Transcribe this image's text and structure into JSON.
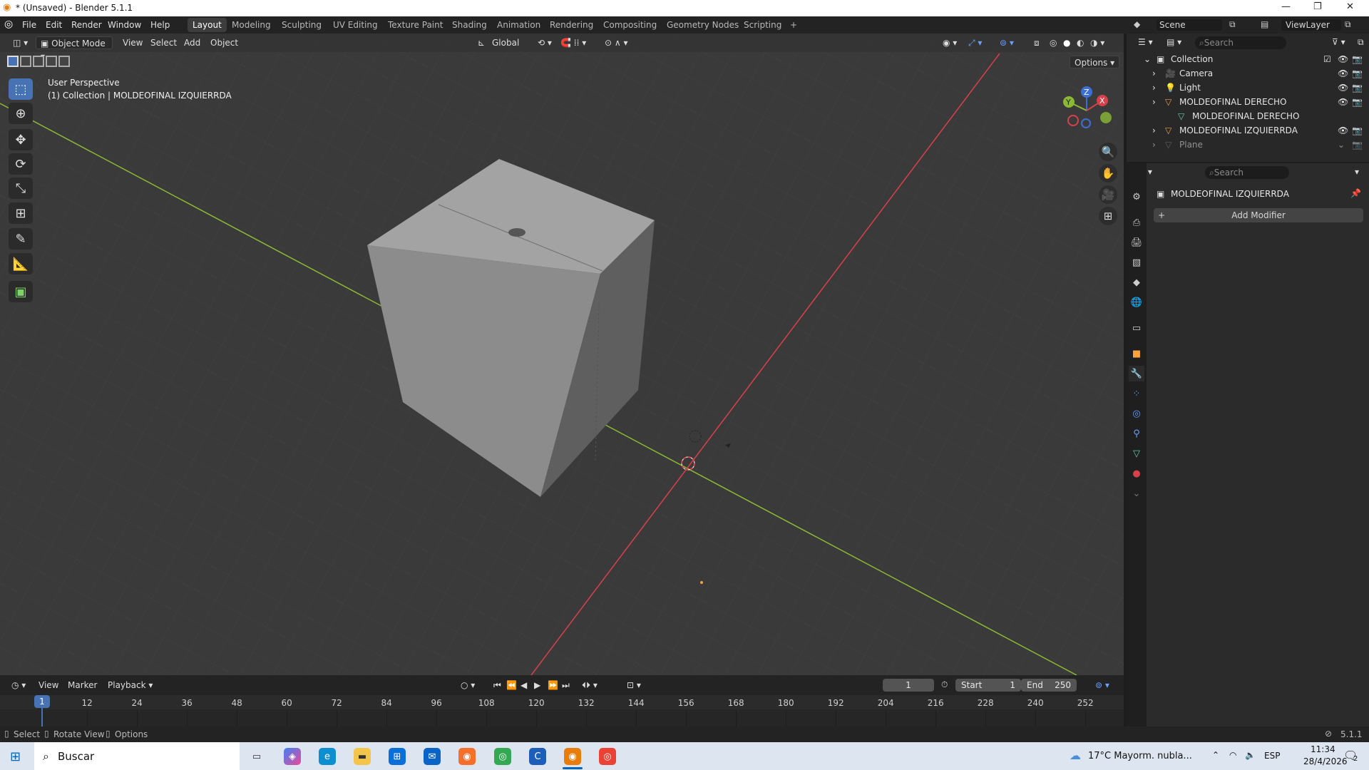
{
  "title_bar": {
    "title": "* (Unsaved) - Blender 5.1.1",
    "minimize": "—",
    "maximize": "❐",
    "close": "✕"
  },
  "menus": [
    "File",
    "Edit",
    "Render",
    "Window",
    "Help"
  ],
  "workspaces": [
    "Layout",
    "Modeling",
    "Sculpting",
    "UV Editing",
    "Texture Paint",
    "Shading",
    "Animation",
    "Rendering",
    "Compositing",
    "Geometry Nodes",
    "Scripting",
    "+"
  ],
  "active_workspace": "Layout",
  "scene": {
    "label": "Scene",
    "view_layer": "ViewLayer"
  },
  "viewport_header": {
    "mode": "Object Mode",
    "menus": [
      "View",
      "Select",
      "Add",
      "Object"
    ],
    "transform_orientation": "Global",
    "options": "Options"
  },
  "viewport_overlay": {
    "perspective": "User Perspective",
    "context": "(1) Collection | MOLDEOFINAL IZQUIERRDA"
  },
  "gizmo": {
    "x": "X",
    "y": "Y",
    "z": "Z"
  },
  "outliner": {
    "search_placeholder": "Search",
    "collection": "Collection",
    "items": [
      {
        "name": "Camera",
        "icon": "camera-icon",
        "color": "#e6a050"
      },
      {
        "name": "Light",
        "icon": "light-icon",
        "color": "#e6a050"
      },
      {
        "name": "MOLDEOFINAL DERECHO",
        "icon": "mesh-icon",
        "color": "#e6a050"
      },
      {
        "name": "MOLDEOFINAL DERECHO",
        "icon": "mesh-data-icon",
        "color": "#62c9a5"
      },
      {
        "name": "MOLDEOFINAL IZQUIERRDA",
        "icon": "mesh-icon",
        "color": "#e6a050"
      },
      {
        "name": "Plane",
        "icon": "mesh-icon",
        "color": "#8a8a8a"
      }
    ]
  },
  "properties": {
    "search_placeholder": "Search",
    "object_name": "MOLDEOFINAL IZQUIERRDA",
    "add_modifier": "Add Modifier"
  },
  "timeline": {
    "menus": [
      "View",
      "Marker",
      "Playback"
    ],
    "current_frame": "1",
    "start_label": "Start",
    "start": "1",
    "end_label": "End",
    "end": "250",
    "ticks": [
      "1",
      "12",
      "24",
      "36",
      "48",
      "60",
      "72",
      "84",
      "96",
      "108",
      "120",
      "132",
      "144",
      "156",
      "168",
      "180",
      "192",
      "204",
      "216",
      "228",
      "240",
      "252"
    ]
  },
  "status_bar": {
    "select": "Select",
    "rotate": "Rotate View",
    "options": "Options",
    "version": "5.1.1"
  },
  "taskbar": {
    "search": "Buscar",
    "weather": "17°C  Mayorm. nubla...",
    "lang": "ESP",
    "time": "11:34",
    "date": "28/4/2026",
    "notifications": "2"
  },
  "colors": {
    "accent": "#4772b3",
    "x_axis": "#d8414b",
    "y_axis": "#8ab934",
    "z_axis": "#3c6fd6",
    "active_orange": "#ffa33a"
  }
}
